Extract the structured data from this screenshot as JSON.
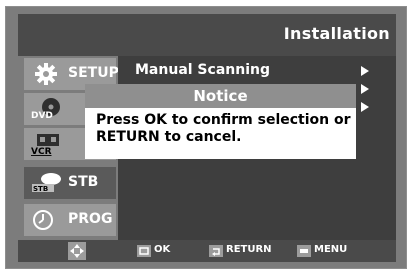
{
  "header": {
    "title": "Installation"
  },
  "sidebar": {
    "items": [
      {
        "label": "SETUP",
        "icon": "gear-icon"
      },
      {
        "label": "",
        "icon": "dvd-icon",
        "icon_text": "DVD"
      },
      {
        "label": "",
        "icon": "vcr-icon",
        "icon_text": "VCR"
      },
      {
        "label": "STB",
        "icon": "stb-icon",
        "icon_text": "STB"
      },
      {
        "label": "PROG",
        "icon": "clock-icon"
      }
    ]
  },
  "menu": {
    "item_label": "Manual Scanning"
  },
  "notice": {
    "title": "Notice",
    "message": "Press OK to confirm selection or RETURN to cancel."
  },
  "footer": {
    "ok_label": "OK",
    "return_label": "RETURN",
    "menu_label": "MENU"
  },
  "colors": {
    "panel": "#7c7c7c",
    "header": "#4a4a4a",
    "content": "#3e3e3e",
    "sidebar_item": "#9a9a9a",
    "sidebar_item_active": "#5a5a5a",
    "notice_title": "#8f8f8f"
  }
}
